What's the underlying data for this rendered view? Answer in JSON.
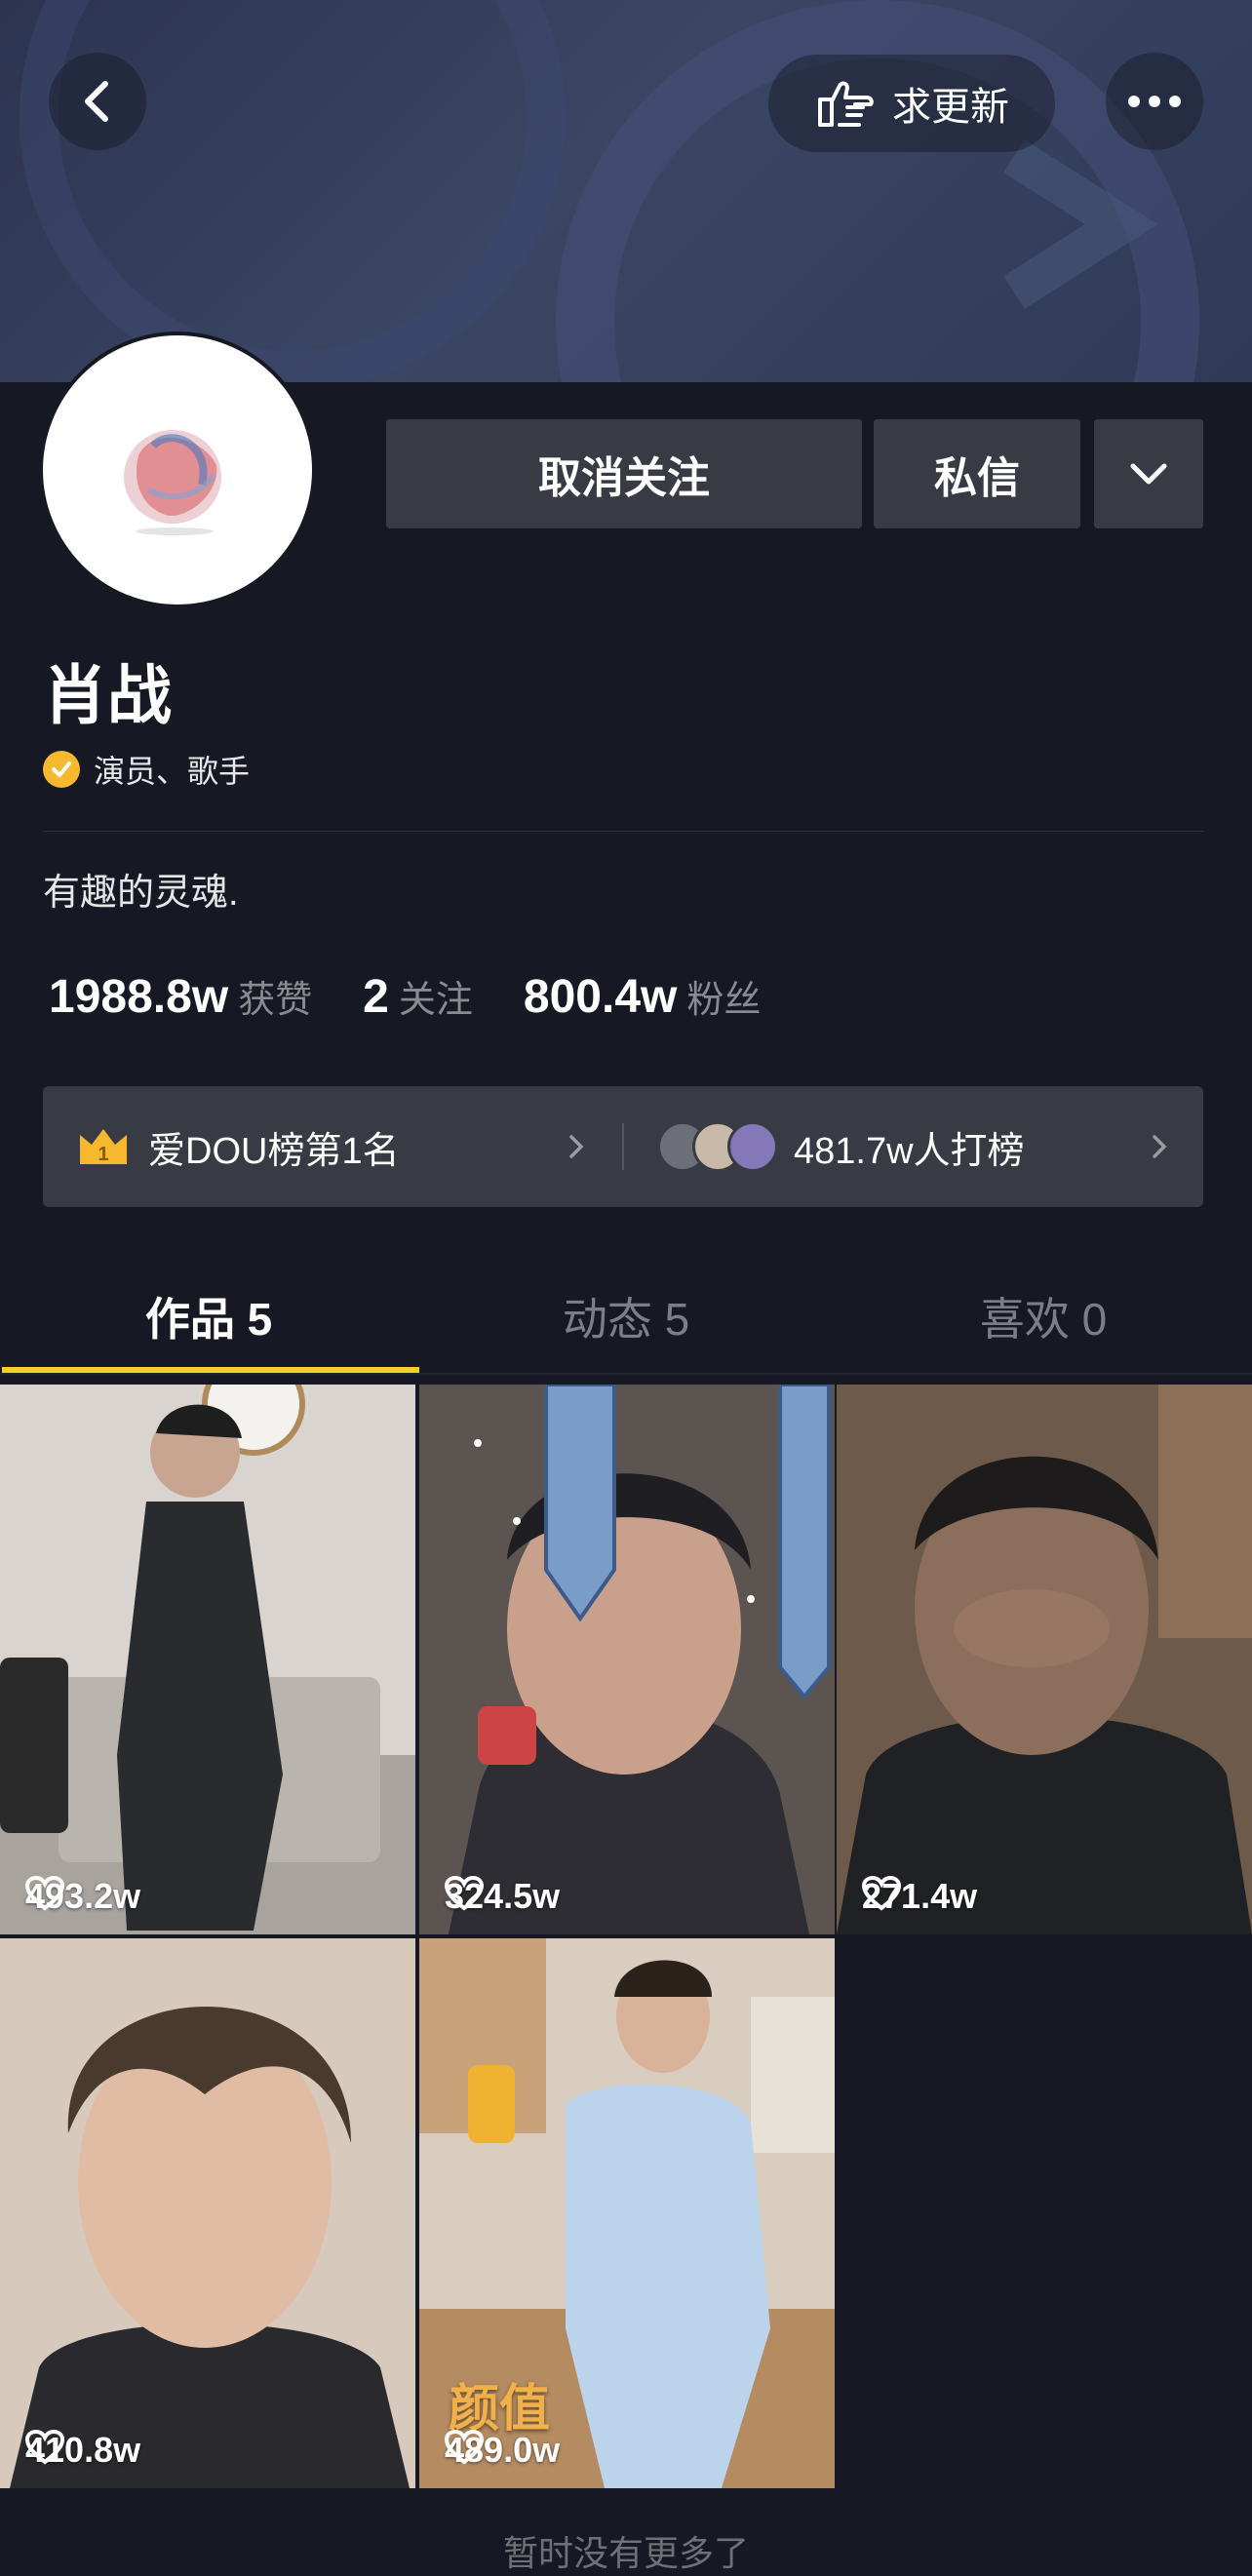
{
  "colors": {
    "background": "#161823",
    "button": "#393b44",
    "accent_yellow": "#facc2d",
    "verified": "#f5b82e",
    "muted_text": "#8a8b91"
  },
  "top_bar": {
    "back_icon": "chevron-left-icon",
    "request_update_icon": "pointing-hand-icon",
    "request_update_label": "求更新",
    "more_icon": "ellipsis-icon"
  },
  "actions": {
    "unfollow_label": "取消关注",
    "message_label": "私信",
    "dropdown_icon": "chevron-down-icon"
  },
  "profile": {
    "name": "肖战",
    "verified_icon": "check-badge-icon",
    "verified_label": "演员、歌手",
    "bio": "有趣的灵魂."
  },
  "stats": {
    "likes_value": "1988.8w",
    "likes_label": "获赞",
    "following_value": "2",
    "following_label": "关注",
    "followers_value": "800.4w",
    "followers_label": "粉丝"
  },
  "rank": {
    "crown_icon": "crown-icon",
    "crown_number": "1",
    "rank_label": "爱DOU榜第1名",
    "voters_label": "481.7w人打榜"
  },
  "tabs": [
    {
      "label": "作品 5",
      "active": true
    },
    {
      "label": "动态 5",
      "active": false
    },
    {
      "label": "喜欢 0",
      "active": false
    }
  ],
  "videos": [
    {
      "likes": "493.2w"
    },
    {
      "likes": "324.5w"
    },
    {
      "likes": "271.4w"
    },
    {
      "likes": "410.8w"
    },
    {
      "likes": "489.0w",
      "overlay_text": "颜值"
    }
  ],
  "footer": {
    "end_text": "暂时没有更多了"
  }
}
